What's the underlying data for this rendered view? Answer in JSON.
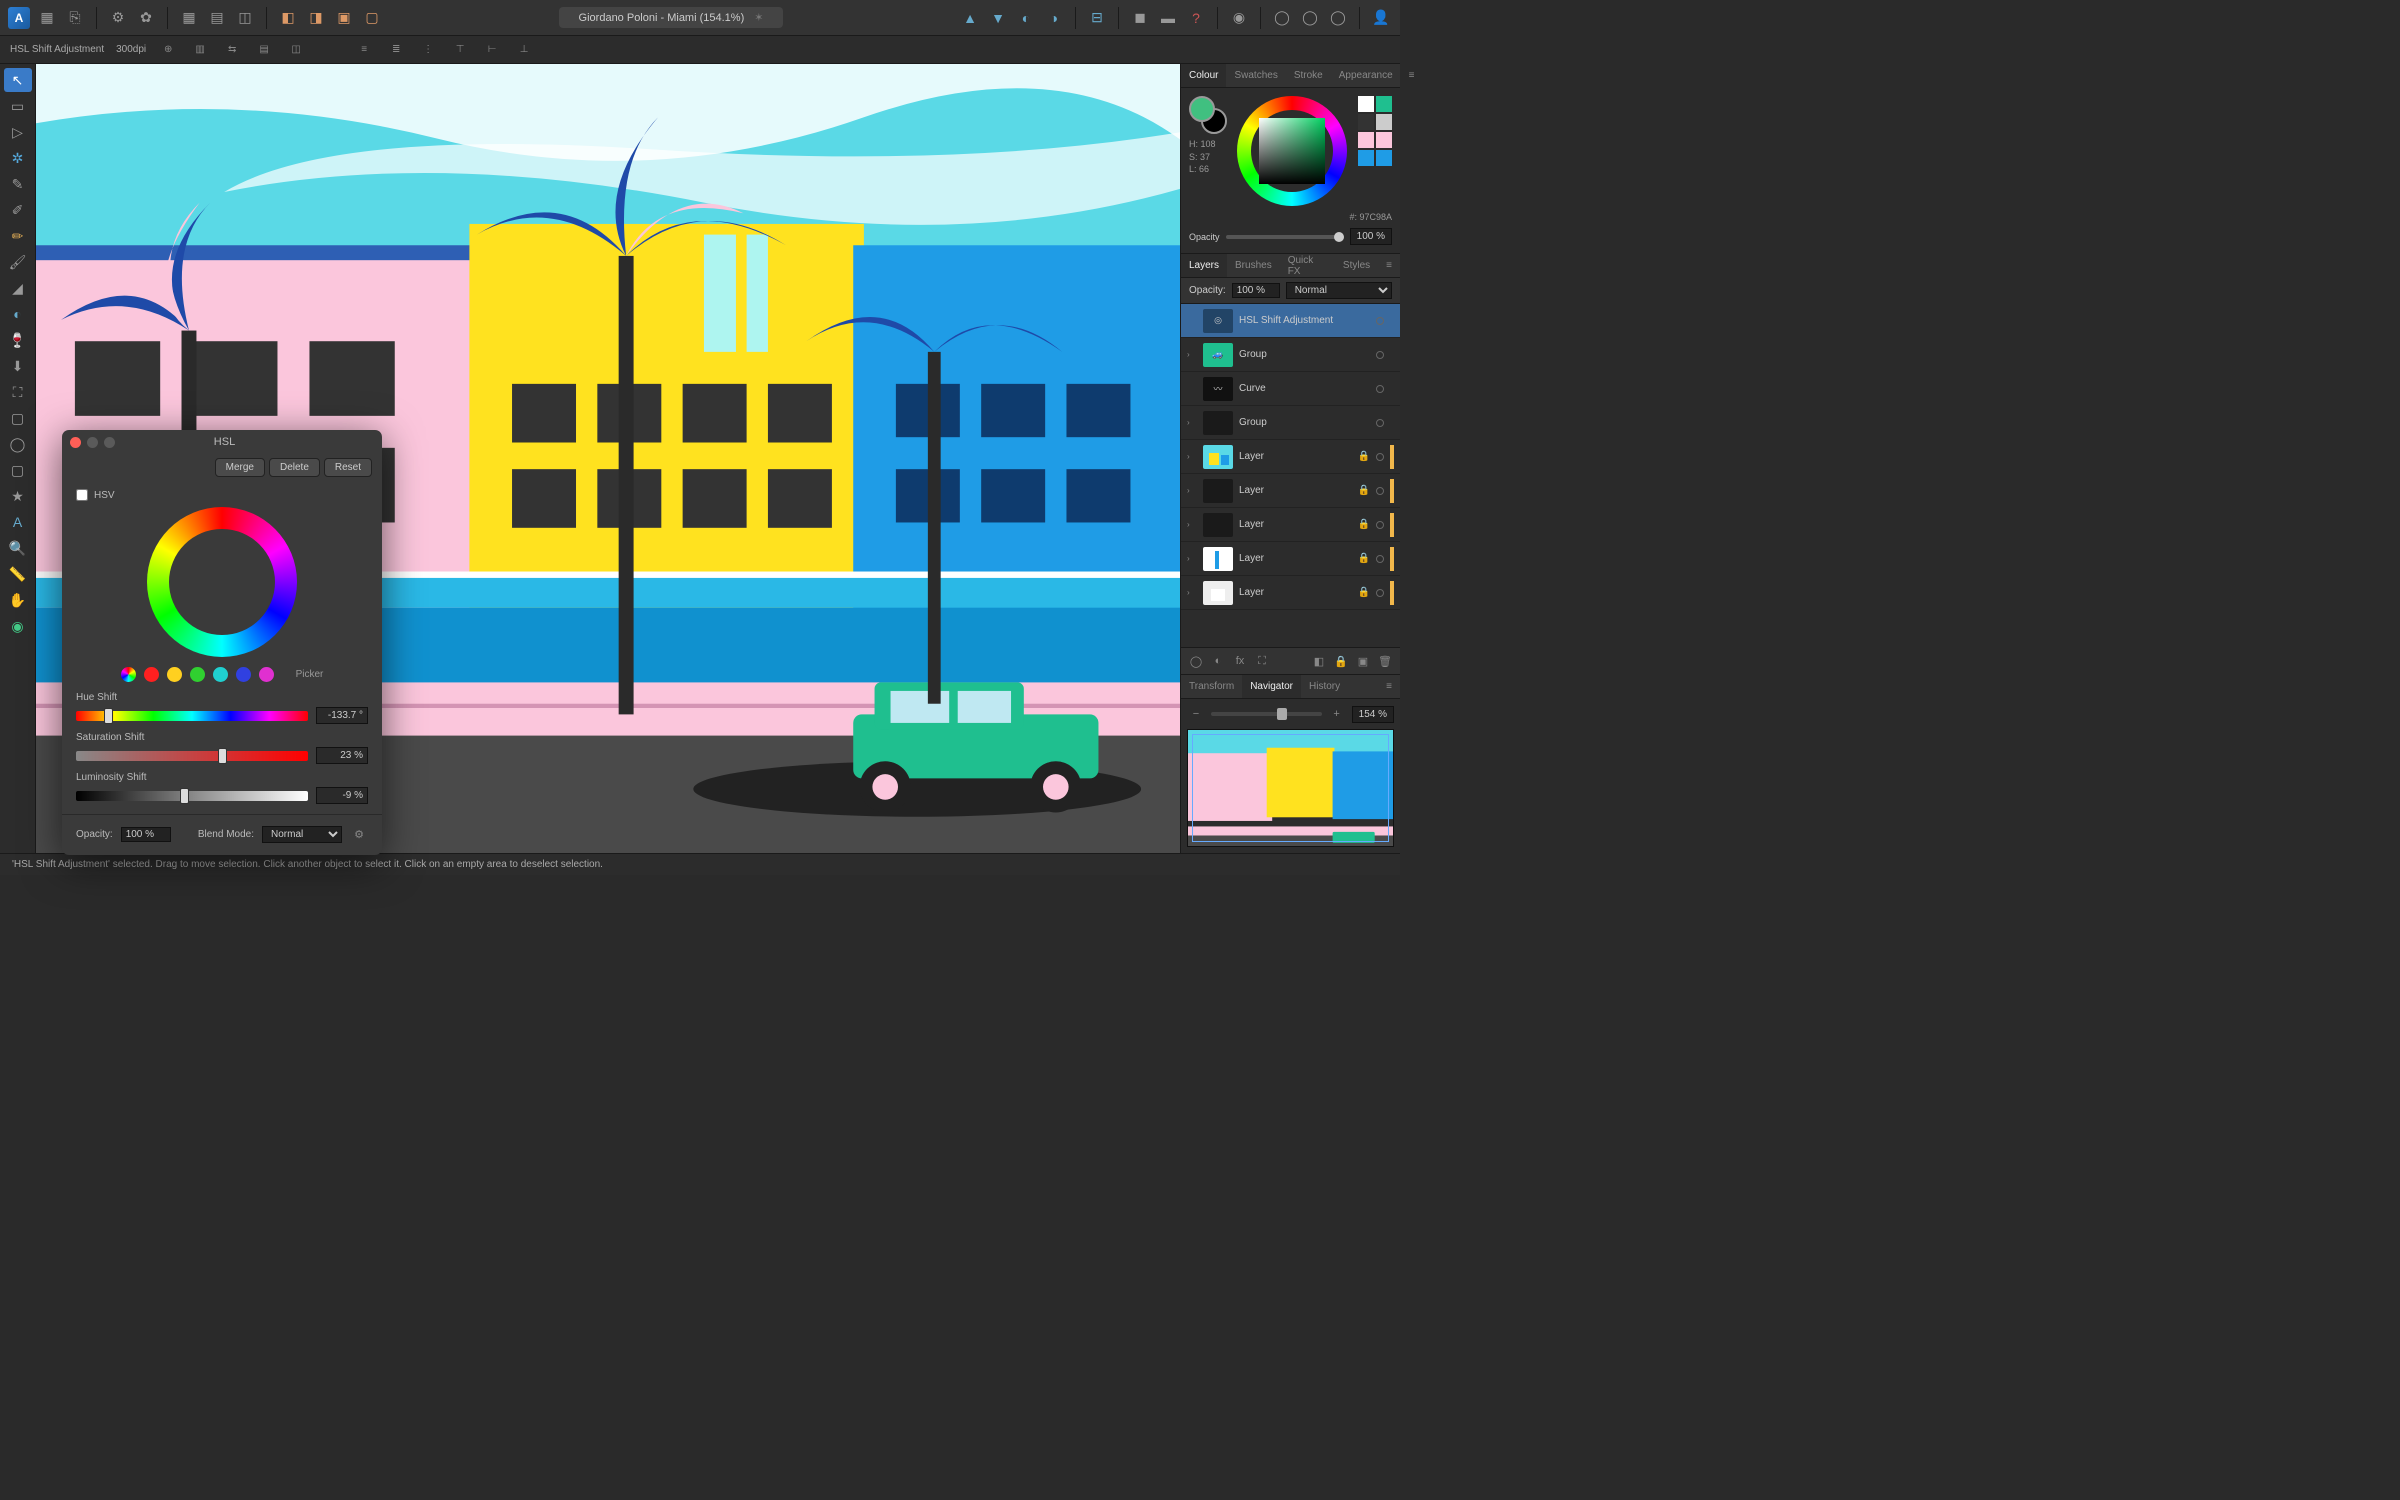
{
  "app": {
    "title": "Giordano Poloni - Miami (154.1%)"
  },
  "context_bar": {
    "label": "HSL Shift Adjustment",
    "dpi": "300dpi"
  },
  "colour": {
    "tabs": [
      "Colour",
      "Swatches",
      "Stroke",
      "Appearance"
    ],
    "h": "H: 108",
    "s": "S: 37",
    "l": "L: 66",
    "hex": "#: 97C98A",
    "opacity_label": "Opacity",
    "opacity_value": "100 %"
  },
  "layers_panel": {
    "tabs": [
      "Layers",
      "Brushes",
      "Quick FX",
      "Styles"
    ],
    "opacity_label": "Opacity:",
    "opacity_value": "100 %",
    "blend": "Normal",
    "items": [
      {
        "name": "HSL Shift Adjustment",
        "selected": true,
        "tag": ""
      },
      {
        "name": "Group",
        "tag": ""
      },
      {
        "name": "Curve",
        "tag": ""
      },
      {
        "name": "Group",
        "tag": ""
      },
      {
        "name": "Layer",
        "tag": "#f2b84b"
      },
      {
        "name": "Layer",
        "tag": "#f2b84b"
      },
      {
        "name": "Layer",
        "tag": "#f2b84b"
      },
      {
        "name": "Layer",
        "tag": "#f2b84b"
      },
      {
        "name": "Layer",
        "tag": "#f2b84b"
      }
    ]
  },
  "navigator": {
    "tabs": [
      "Transform",
      "Navigator",
      "History"
    ],
    "zoom": "154 %"
  },
  "hsl": {
    "title": "HSL",
    "merge": "Merge",
    "delete": "Delete",
    "reset": "Reset",
    "hsv_label": "HSV",
    "picker": "Picker",
    "hue_label": "Hue Shift",
    "hue_val": "-133.7 °",
    "sat_label": "Saturation Shift",
    "sat_val": "23 %",
    "lum_label": "Luminosity Shift",
    "lum_val": "-9 %",
    "opacity_label": "Opacity:",
    "opacity_val": "100 %",
    "blend_label": "Blend Mode:",
    "blend_val": "Normal"
  },
  "status": {
    "text": "'HSL Shift Adjustment' selected. Drag to move selection. Click another object to select it. Click on an empty area to deselect selection."
  }
}
